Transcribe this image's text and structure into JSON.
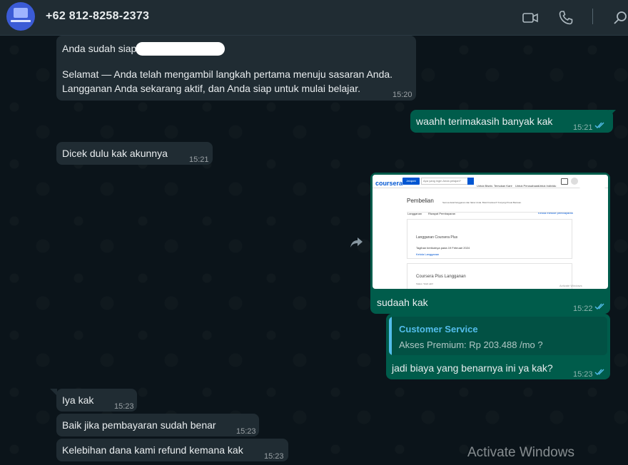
{
  "header": {
    "contact_name": "+62 812-8258-2373",
    "icons": [
      "video-call-icon",
      "voice-call-icon",
      "search-icon"
    ]
  },
  "messages": {
    "m1": {
      "line1": "Anda sudah siap",
      "line2": "Selamat — Anda telah mengambil langkah pertama menuju sasaran Anda.",
      "line3": "Langganan Anda sekarang aktif, dan Anda siap untuk mulai belajar.",
      "time": "15:20"
    },
    "m2": {
      "text": "waahh terimakasih banyak kak",
      "time": "15:21"
    },
    "m3": {
      "text": "Dicek dulu kak akunnya",
      "time": "15:21"
    },
    "m4": {
      "caption": "sudaah kak",
      "time": "15:22",
      "screenshot": {
        "logo": "coursera",
        "explore": "Jelajahi",
        "search_placeholder": "Apa yang ingin Anda pelajari?",
        "nav": [
          "Untuk Bisnis",
          "Temukan Karir",
          "Untuk Perusahaan",
          "Untuk Individu"
        ],
        "page_title": "Pembelian",
        "page_subtitle": "Semua detail langganan dan faktur Anda. Butuh bantuan? Kunjungi Pusat Bantuan.",
        "tabs": [
          "Langganan",
          "Riwayat Pembayaran"
        ],
        "link": "Kelola metode pembayaran",
        "card1_title": "Langganan Coursera Plus",
        "card1_line": "Tagihan berikutnya pada 19 Februari 2024",
        "card1_link": "Kelola Langganan",
        "card2_title": "Coursera Plus Langganan",
        "card2_sub": "Status: Telah aktif",
        "activate": "Activate Windows"
      }
    },
    "m5": {
      "quote_name": "Customer Service",
      "quote_text": "Akses Premium: Rp 203.488 /mo ?",
      "text": "jadi biaya yang benarnya ini ya kak?",
      "time": "15:23"
    },
    "m6": {
      "text": "Iya kak",
      "time": "15:23"
    },
    "m7": {
      "text": "Baik jika pembayaran sudah benar",
      "time": "15:23"
    },
    "m8": {
      "text": "Kelebihan dana kami refund kemana kak",
      "time": "15:23"
    }
  },
  "watermark": "Activate Windows",
  "colors": {
    "header": "#202c33",
    "background": "#0b141a",
    "incoming": "#202c33",
    "outgoing": "#005c4b",
    "read_ticks": "#53bdeb"
  }
}
